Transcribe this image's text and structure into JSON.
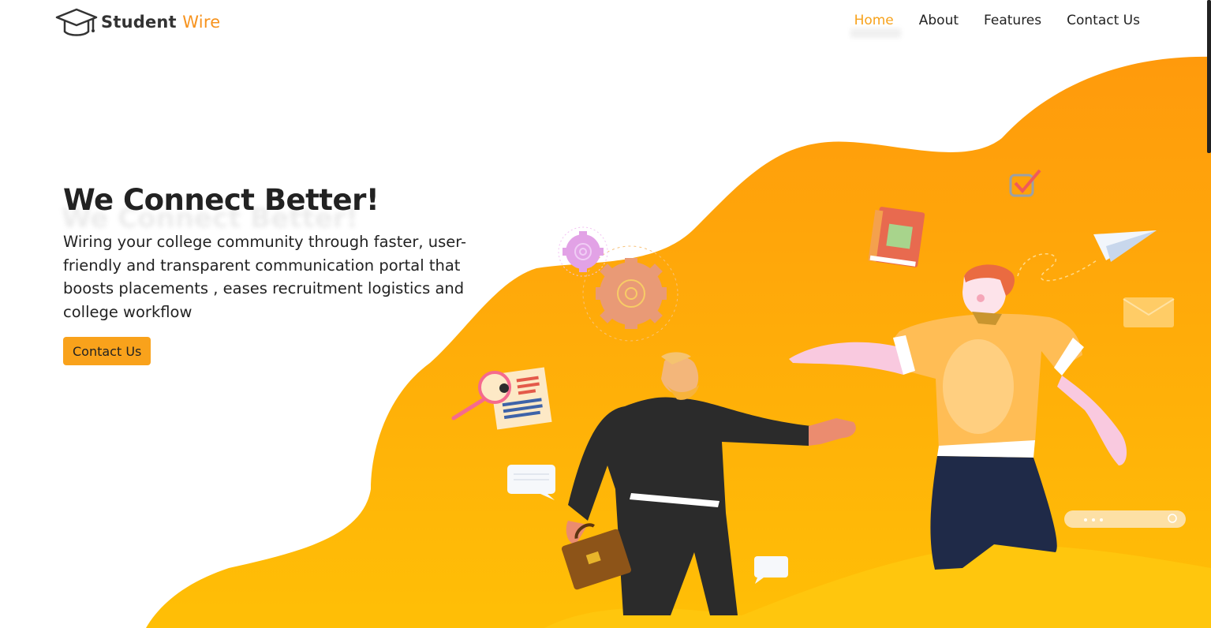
{
  "brand": {
    "name_part1": "Student",
    "name_part2": "Wire"
  },
  "nav": {
    "home": "Home",
    "about": "About",
    "features": "Features",
    "contact": "Contact Us"
  },
  "hero": {
    "title": "We Connect Better!",
    "description": "Wiring your college community through faster, user-friendly and transparent communication portal that boosts placements , eases recruitment logistics and college workflow",
    "cta_label": "Contact Us"
  },
  "colors": {
    "accent": "#f9a21b",
    "blob_top": "#ff9d0a",
    "blob_bottom": "#ffc000",
    "active_nav": "#f7a21b"
  },
  "icons": [
    "graduation-cap-icon",
    "gear-icon",
    "resume-icon",
    "magnifier-icon",
    "book-icon",
    "checkbox-icon",
    "paper-plane-icon",
    "envelope-icon",
    "chat-bubble-icon",
    "search-bar-icon",
    "briefcase-icon"
  ]
}
